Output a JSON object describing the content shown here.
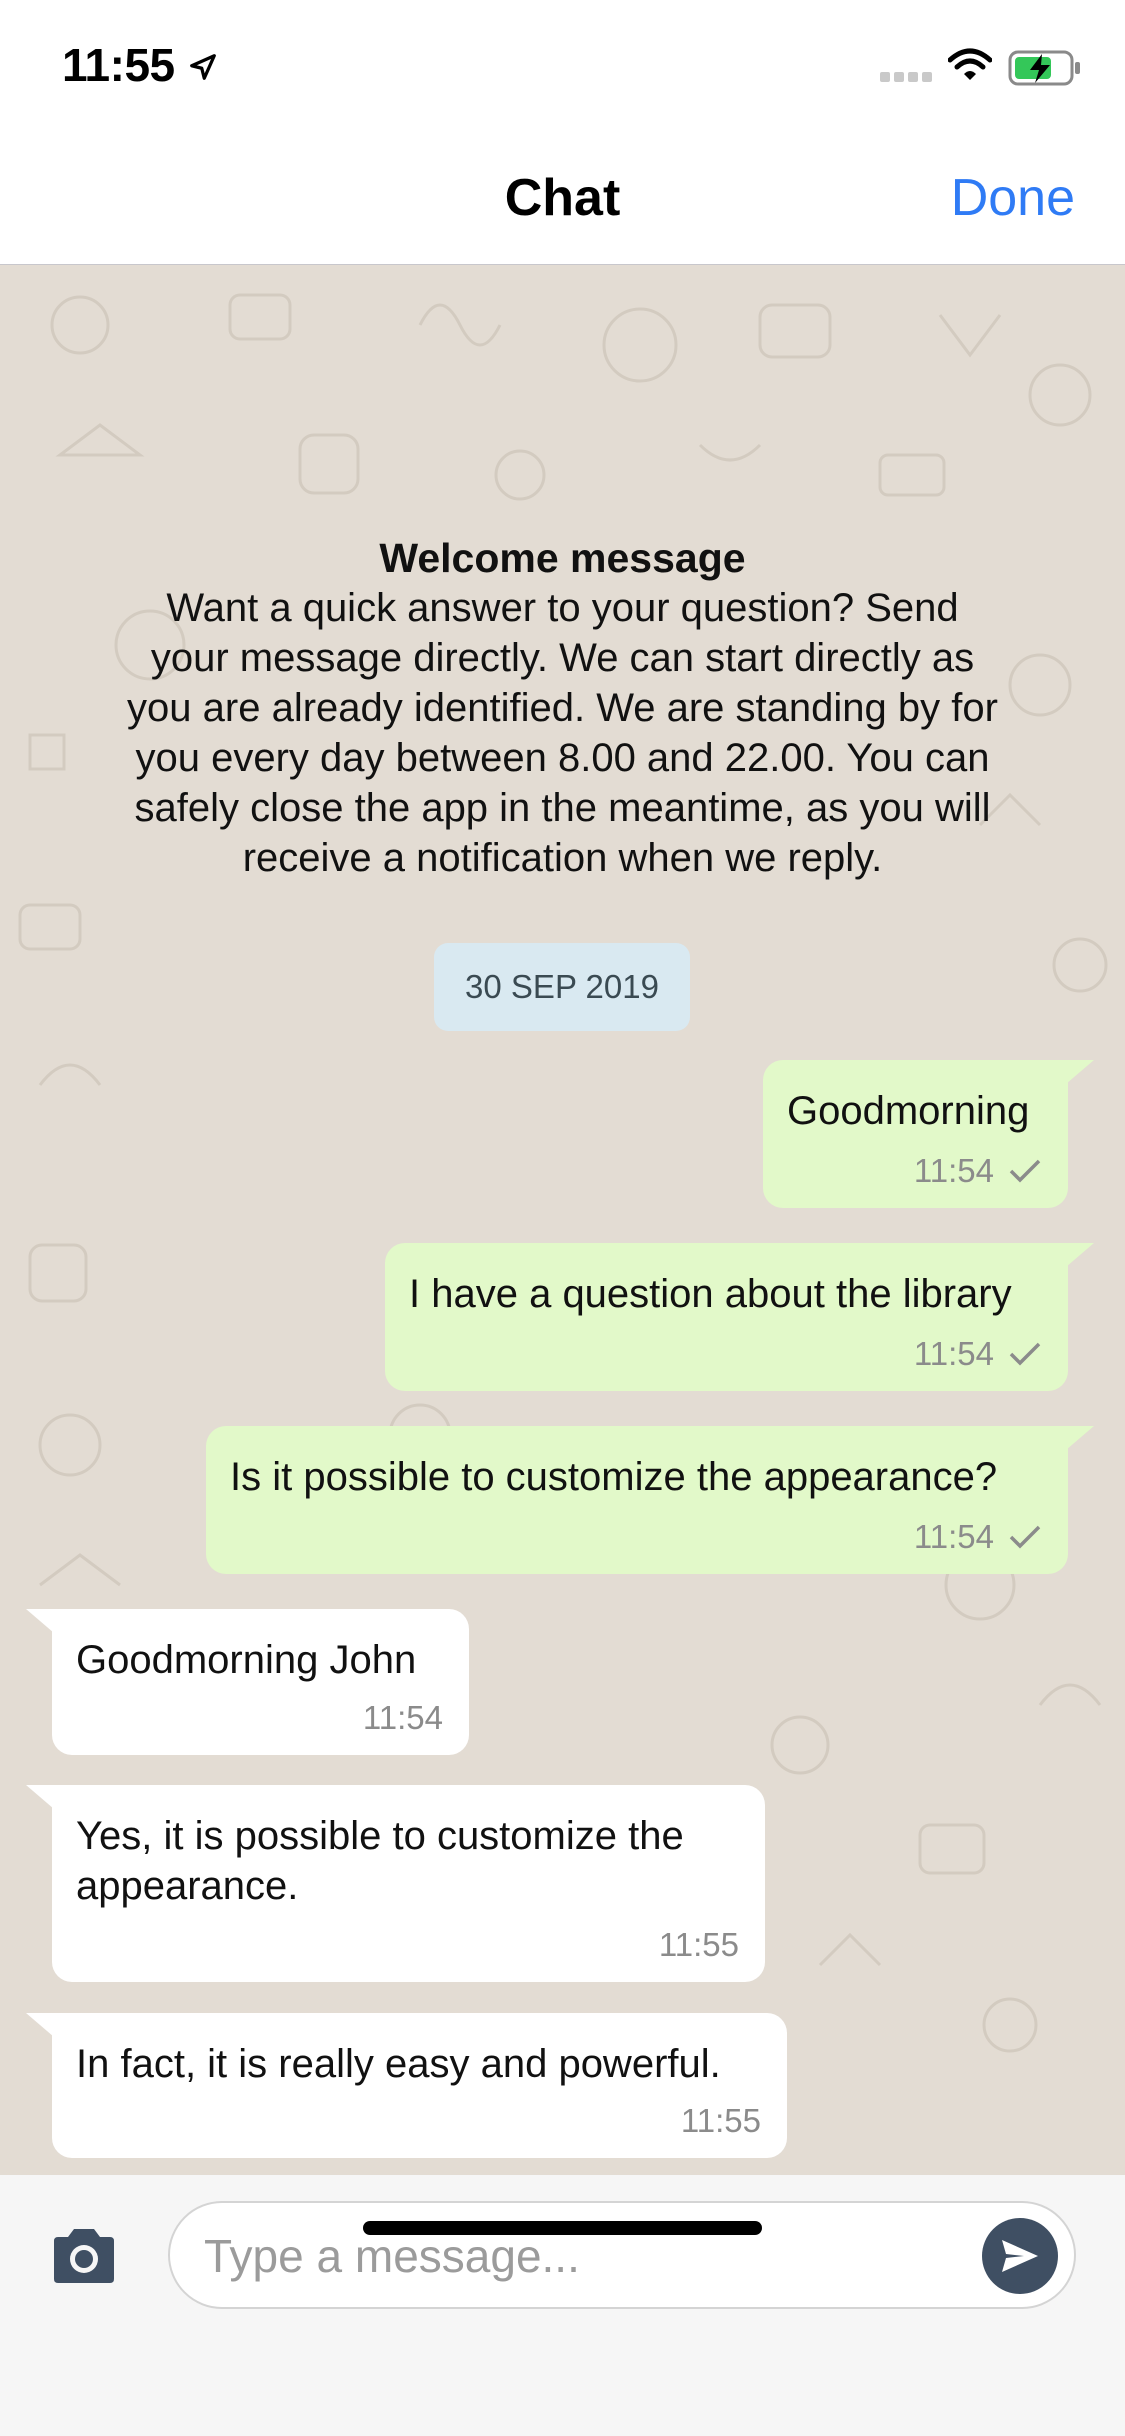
{
  "status_bar": {
    "time": "11:55",
    "icons": [
      "location-arrow-icon",
      "signal-icon",
      "wifi-icon",
      "battery-charging-icon"
    ]
  },
  "nav": {
    "title": "Chat",
    "done_label": "Done",
    "accent_color": "#2f7bf5"
  },
  "welcome": {
    "title": "Welcome message",
    "lines": [
      "Want a quick answer to your question? Send",
      "your message directly. We can start directly as",
      "you are already identified. We are standing by for",
      "you every day between 8.00  and 22.00. You can",
      "safely close the app in the meantime, as you will",
      "receive a notification when we reply."
    ]
  },
  "date_badge": "30 SEP 2019",
  "messages": [
    {
      "direction": "outgoing",
      "text": "Goodmorning",
      "time": "11:54",
      "status": "sent-check"
    },
    {
      "direction": "outgoing",
      "text": "I have a question about the library",
      "time": "11:54",
      "status": "sent-check"
    },
    {
      "direction": "outgoing",
      "text": "Is it possible to customize the appearance?",
      "time": "11:54",
      "status": "sent-check"
    },
    {
      "direction": "incoming",
      "lines": [
        "Goodmorning John"
      ],
      "time": "11:54"
    },
    {
      "direction": "incoming",
      "lines": [
        "Yes, it is possible to customize the",
        "appearance."
      ],
      "time": "11:55"
    },
    {
      "direction": "incoming",
      "lines": [
        "In fact, it is really easy and powerful."
      ],
      "time": "11:55"
    }
  ],
  "input_bar": {
    "placeholder": "Type a message...",
    "value": "",
    "camera_icon": "camera-icon",
    "send_icon": "send-icon"
  },
  "colors": {
    "outgoing_bubble": "#e2f9c9",
    "incoming_bubble": "#ffffff",
    "chat_background": "#e3dcd3",
    "date_badge": "#d9e9f1",
    "send_button": "#3f4f63"
  }
}
